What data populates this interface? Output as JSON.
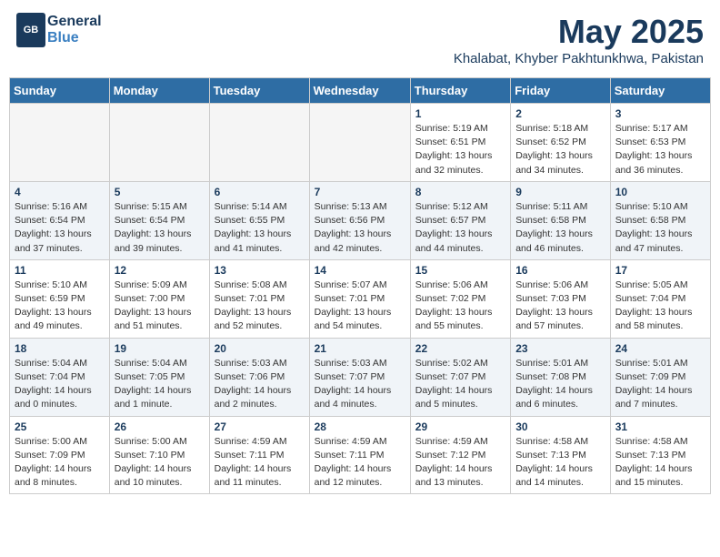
{
  "header": {
    "logo_general": "General",
    "logo_blue": "Blue",
    "month": "May 2025",
    "location": "Khalabat, Khyber Pakhtunkhwa, Pakistan"
  },
  "weekdays": [
    "Sunday",
    "Monday",
    "Tuesday",
    "Wednesday",
    "Thursday",
    "Friday",
    "Saturday"
  ],
  "weeks": [
    [
      {
        "day": "",
        "info": ""
      },
      {
        "day": "",
        "info": ""
      },
      {
        "day": "",
        "info": ""
      },
      {
        "day": "",
        "info": ""
      },
      {
        "day": "1",
        "info": "Sunrise: 5:19 AM\nSunset: 6:51 PM\nDaylight: 13 hours\nand 32 minutes."
      },
      {
        "day": "2",
        "info": "Sunrise: 5:18 AM\nSunset: 6:52 PM\nDaylight: 13 hours\nand 34 minutes."
      },
      {
        "day": "3",
        "info": "Sunrise: 5:17 AM\nSunset: 6:53 PM\nDaylight: 13 hours\nand 36 minutes."
      }
    ],
    [
      {
        "day": "4",
        "info": "Sunrise: 5:16 AM\nSunset: 6:54 PM\nDaylight: 13 hours\nand 37 minutes."
      },
      {
        "day": "5",
        "info": "Sunrise: 5:15 AM\nSunset: 6:54 PM\nDaylight: 13 hours\nand 39 minutes."
      },
      {
        "day": "6",
        "info": "Sunrise: 5:14 AM\nSunset: 6:55 PM\nDaylight: 13 hours\nand 41 minutes."
      },
      {
        "day": "7",
        "info": "Sunrise: 5:13 AM\nSunset: 6:56 PM\nDaylight: 13 hours\nand 42 minutes."
      },
      {
        "day": "8",
        "info": "Sunrise: 5:12 AM\nSunset: 6:57 PM\nDaylight: 13 hours\nand 44 minutes."
      },
      {
        "day": "9",
        "info": "Sunrise: 5:11 AM\nSunset: 6:58 PM\nDaylight: 13 hours\nand 46 minutes."
      },
      {
        "day": "10",
        "info": "Sunrise: 5:10 AM\nSunset: 6:58 PM\nDaylight: 13 hours\nand 47 minutes."
      }
    ],
    [
      {
        "day": "11",
        "info": "Sunrise: 5:10 AM\nSunset: 6:59 PM\nDaylight: 13 hours\nand 49 minutes."
      },
      {
        "day": "12",
        "info": "Sunrise: 5:09 AM\nSunset: 7:00 PM\nDaylight: 13 hours\nand 51 minutes."
      },
      {
        "day": "13",
        "info": "Sunrise: 5:08 AM\nSunset: 7:01 PM\nDaylight: 13 hours\nand 52 minutes."
      },
      {
        "day": "14",
        "info": "Sunrise: 5:07 AM\nSunset: 7:01 PM\nDaylight: 13 hours\nand 54 minutes."
      },
      {
        "day": "15",
        "info": "Sunrise: 5:06 AM\nSunset: 7:02 PM\nDaylight: 13 hours\nand 55 minutes."
      },
      {
        "day": "16",
        "info": "Sunrise: 5:06 AM\nSunset: 7:03 PM\nDaylight: 13 hours\nand 57 minutes."
      },
      {
        "day": "17",
        "info": "Sunrise: 5:05 AM\nSunset: 7:04 PM\nDaylight: 13 hours\nand 58 minutes."
      }
    ],
    [
      {
        "day": "18",
        "info": "Sunrise: 5:04 AM\nSunset: 7:04 PM\nDaylight: 14 hours\nand 0 minutes."
      },
      {
        "day": "19",
        "info": "Sunrise: 5:04 AM\nSunset: 7:05 PM\nDaylight: 14 hours\nand 1 minute."
      },
      {
        "day": "20",
        "info": "Sunrise: 5:03 AM\nSunset: 7:06 PM\nDaylight: 14 hours\nand 2 minutes."
      },
      {
        "day": "21",
        "info": "Sunrise: 5:03 AM\nSunset: 7:07 PM\nDaylight: 14 hours\nand 4 minutes."
      },
      {
        "day": "22",
        "info": "Sunrise: 5:02 AM\nSunset: 7:07 PM\nDaylight: 14 hours\nand 5 minutes."
      },
      {
        "day": "23",
        "info": "Sunrise: 5:01 AM\nSunset: 7:08 PM\nDaylight: 14 hours\nand 6 minutes."
      },
      {
        "day": "24",
        "info": "Sunrise: 5:01 AM\nSunset: 7:09 PM\nDaylight: 14 hours\nand 7 minutes."
      }
    ],
    [
      {
        "day": "25",
        "info": "Sunrise: 5:00 AM\nSunset: 7:09 PM\nDaylight: 14 hours\nand 8 minutes."
      },
      {
        "day": "26",
        "info": "Sunrise: 5:00 AM\nSunset: 7:10 PM\nDaylight: 14 hours\nand 10 minutes."
      },
      {
        "day": "27",
        "info": "Sunrise: 4:59 AM\nSunset: 7:11 PM\nDaylight: 14 hours\nand 11 minutes."
      },
      {
        "day": "28",
        "info": "Sunrise: 4:59 AM\nSunset: 7:11 PM\nDaylight: 14 hours\nand 12 minutes."
      },
      {
        "day": "29",
        "info": "Sunrise: 4:59 AM\nSunset: 7:12 PM\nDaylight: 14 hours\nand 13 minutes."
      },
      {
        "day": "30",
        "info": "Sunrise: 4:58 AM\nSunset: 7:13 PM\nDaylight: 14 hours\nand 14 minutes."
      },
      {
        "day": "31",
        "info": "Sunrise: 4:58 AM\nSunset: 7:13 PM\nDaylight: 14 hours\nand 15 minutes."
      }
    ]
  ]
}
